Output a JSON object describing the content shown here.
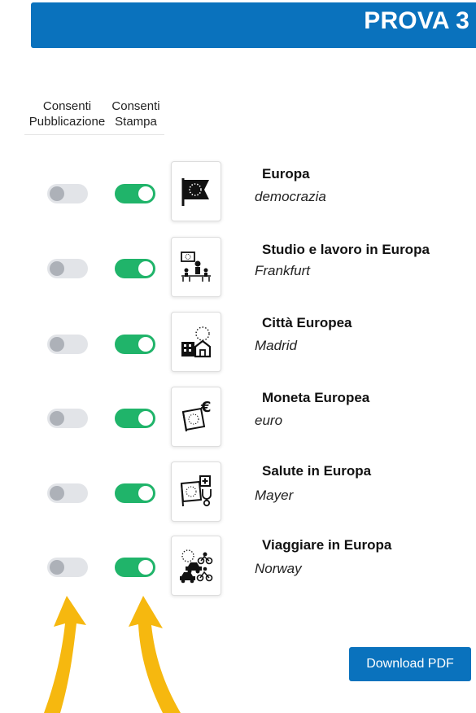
{
  "header": {
    "title": "PROVA 3"
  },
  "columns": {
    "publish_label": "Consenti Pubblicazione",
    "print_label": "Consenti Stampa"
  },
  "items": [
    {
      "title": "Europa",
      "subtitle": "democrazia",
      "icon": "eu-flag-icon",
      "publish": false,
      "print": true
    },
    {
      "title": "Studio e lavoro in Europa",
      "subtitle": "Frankfurt",
      "icon": "classroom-icon",
      "publish": false,
      "print": true
    },
    {
      "title": "Città Europea",
      "subtitle": "Madrid",
      "icon": "city-buildings-icon",
      "publish": false,
      "print": true
    },
    {
      "title": "Moneta Europea",
      "subtitle": "euro",
      "icon": "euro-flag-icon",
      "publish": false,
      "print": true
    },
    {
      "title": "Salute in Europa",
      "subtitle": "Mayer",
      "icon": "health-flag-icon",
      "publish": false,
      "print": true
    },
    {
      "title": "Viaggiare in Europa",
      "subtitle": "Norway",
      "icon": "travel-icon",
      "publish": false,
      "print": true
    }
  ],
  "actions": {
    "download_label": "Download PDF"
  },
  "colors": {
    "brand_blue": "#0a72bd",
    "toggle_on": "#20b46a",
    "toggle_off": "#e2e4e8",
    "annotation_arrow": "#f6b80f"
  }
}
